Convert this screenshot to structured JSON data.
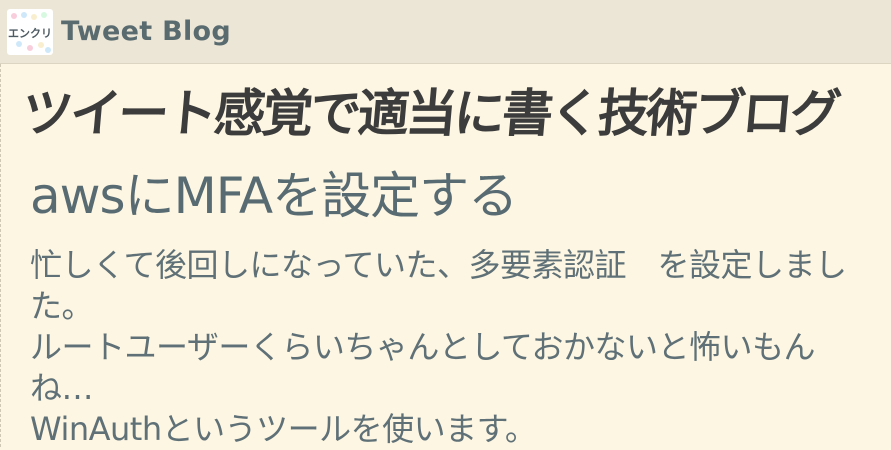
{
  "header": {
    "logo_text": "エンクリ",
    "site_title": "Tweet Blog"
  },
  "banner": {
    "text": "ツイート感覚で適当に書く技術ブログ"
  },
  "post": {
    "title": "awsにMFAを設定する",
    "paragraphs": [
      "忙しくて後回しになっていた、多要素認証　を設定しました。",
      "ルートユーザーくらいちゃんとしておかないと怖いもんね…",
      "WinAuthというツールを使います。"
    ]
  },
  "colors": {
    "background": "#fdf6e3",
    "header_background": "#ece6d6",
    "title_text": "#586b72",
    "banner_text": "#3c3c3c"
  }
}
